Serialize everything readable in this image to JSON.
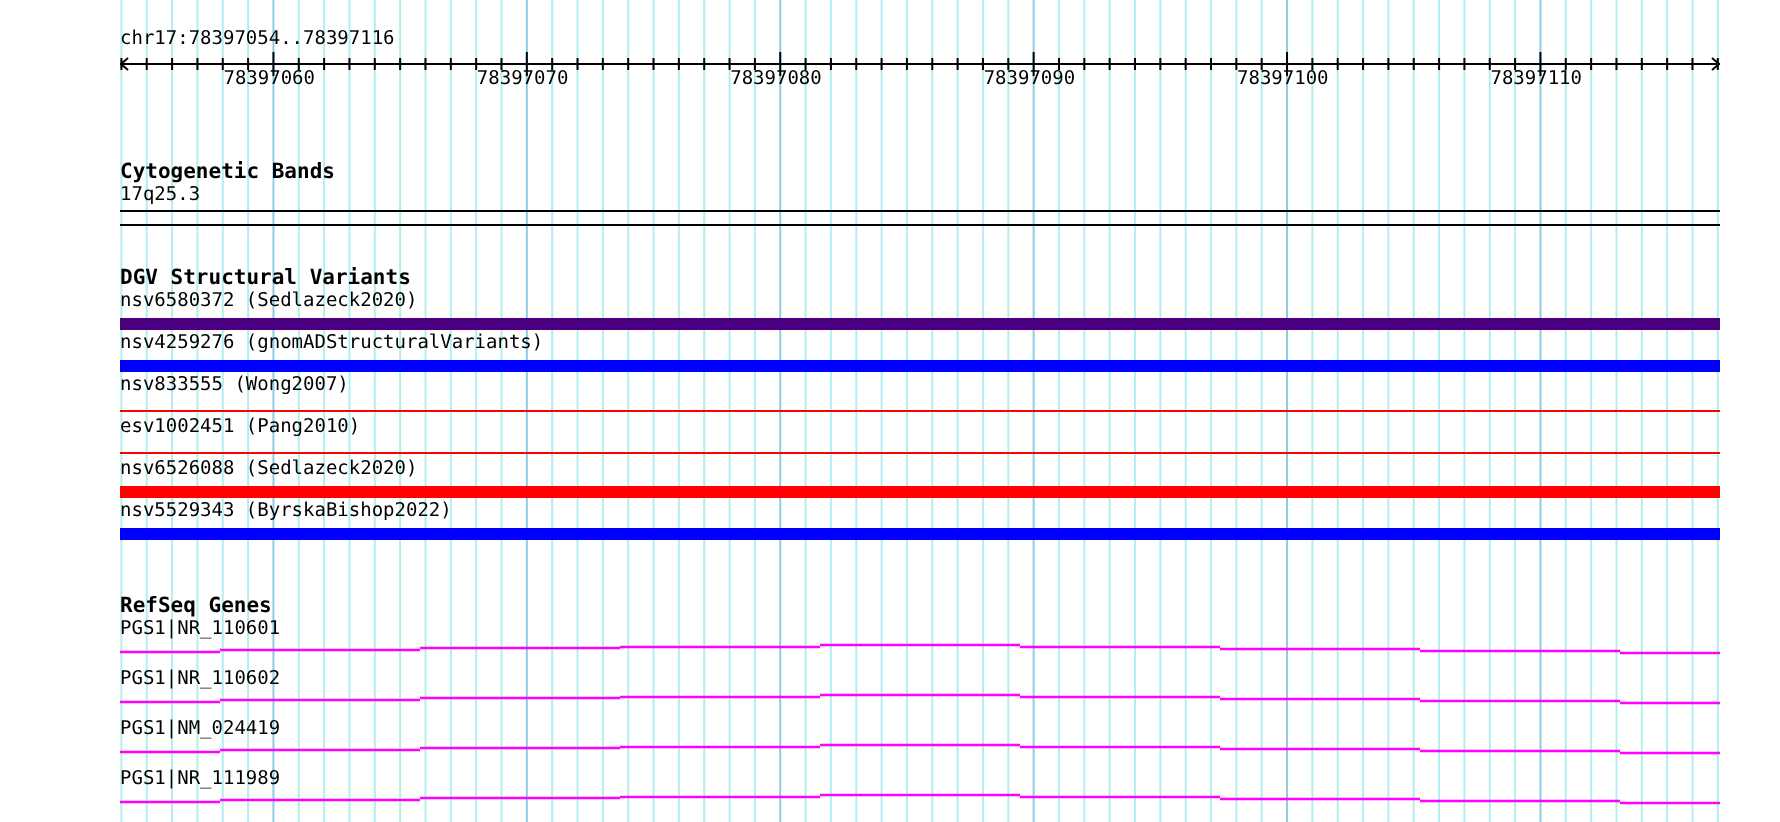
{
  "ruler": {
    "range": "chr17:78397054..78397116",
    "tick_labels": [
      "78397060",
      "78397070",
      "78397080",
      "78397090",
      "78397100",
      "78397110"
    ]
  },
  "cytogenetic_bands": {
    "title": "Cytogenetic Bands",
    "band": "17q25.3"
  },
  "dgv_structural_variants": {
    "title": "DGV Structural Variants",
    "variants": [
      {
        "label": "nsv6580372 (Sedlazeck2020)",
        "color": "#4b0082",
        "kind": "thick"
      },
      {
        "label": "nsv4259276 (gnomADStructuralVariants)",
        "color": "#0000ff",
        "kind": "thick"
      },
      {
        "label": "nsv833555 (Wong2007)",
        "color": "#ff0000",
        "kind": "thin"
      },
      {
        "label": "esv1002451 (Pang2010)",
        "color": "#ff0000",
        "kind": "thin"
      },
      {
        "label": "nsv6526088 (Sedlazeck2020)",
        "color": "#ff0000",
        "kind": "thick"
      },
      {
        "label": "nsv5529343 (ByrskaBishop2022)",
        "color": "#0000ff",
        "kind": "thick"
      }
    ]
  },
  "refseq_genes": {
    "title": "RefSeq Genes",
    "genes": [
      {
        "label": "PGS1|NR_110601"
      },
      {
        "label": "PGS1|NR_110602"
      },
      {
        "label": "PGS1|NM_024419"
      },
      {
        "label": "PGS1|NR_111989"
      }
    ]
  }
}
